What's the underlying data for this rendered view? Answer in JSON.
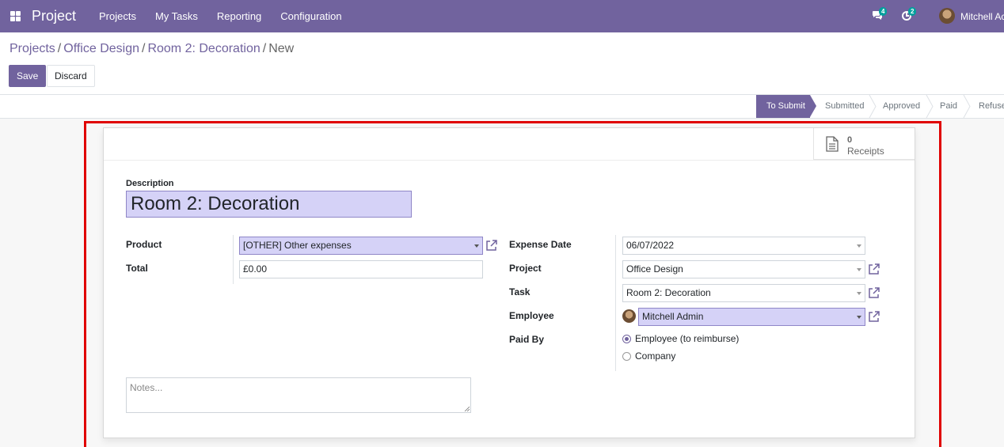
{
  "navbar": {
    "brand": "Project",
    "menu": [
      "Projects",
      "My Tasks",
      "Reporting",
      "Configuration"
    ],
    "messages_count": "4",
    "activities_count": "2",
    "user_name": "Mitchell Ac"
  },
  "breadcrumb": {
    "items": [
      "Projects",
      "Office Design",
      "Room 2: Decoration"
    ],
    "current": "New",
    "separator": "/"
  },
  "buttons": {
    "save": "Save",
    "discard": "Discard"
  },
  "status_stages": [
    "To Submit",
    "Submitted",
    "Approved",
    "Paid",
    "Refuse"
  ],
  "active_stage": "To Submit",
  "smart_button": {
    "count": "0",
    "label": "Receipts",
    "icon": "receipt-icon"
  },
  "form": {
    "description_label": "Description",
    "description_value": "Room 2: Decoration",
    "product_label": "Product",
    "product_value": "[OTHER] Other expenses",
    "total_label": "Total",
    "total_value": "£0.00",
    "expense_date_label": "Expense Date",
    "expense_date_value": "06/07/2022",
    "project_label": "Project",
    "project_value": "Office Design",
    "task_label": "Task",
    "task_value": "Room 2: Decoration",
    "employee_label": "Employee",
    "employee_value": "Mitchell Admin",
    "paid_by_label": "Paid By",
    "paid_by_options": [
      "Employee (to reimburse)",
      "Company"
    ],
    "paid_by_selected": "Employee (to reimburse)",
    "notes_placeholder": "Notes..."
  },
  "colors": {
    "brand": "#71639e",
    "required_field": "#d5d2f7",
    "highlight_border": "#e00000",
    "badge": "#00a09d"
  }
}
